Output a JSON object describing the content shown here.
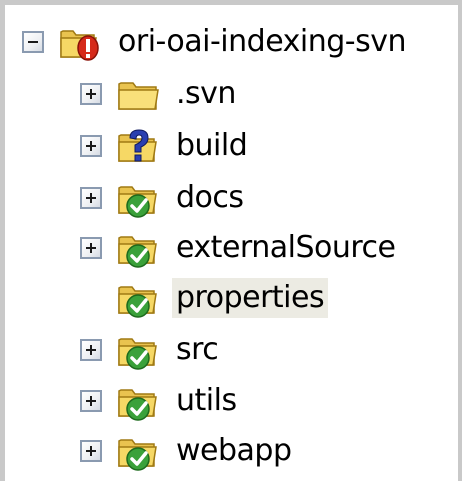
{
  "tree": {
    "root": {
      "label": "ori-oai-indexing-svn",
      "expanded": true,
      "status": "conflict",
      "icon": "folder-conflict-icon"
    },
    "children": [
      {
        "label": ".svn",
        "expandable": true,
        "status": "none",
        "icon": "folder-icon"
      },
      {
        "label": "build",
        "expandable": true,
        "status": "unversioned",
        "icon": "folder-question-icon"
      },
      {
        "label": "docs",
        "expandable": true,
        "status": "normal",
        "icon": "folder-ok-icon"
      },
      {
        "label": "externalSource",
        "expandable": true,
        "status": "normal",
        "icon": "folder-ok-icon"
      },
      {
        "label": "properties",
        "expandable": false,
        "status": "normal",
        "icon": "folder-ok-icon",
        "selected": true
      },
      {
        "label": "src",
        "expandable": true,
        "status": "normal",
        "icon": "folder-ok-icon"
      },
      {
        "label": "utils",
        "expandable": true,
        "status": "normal",
        "icon": "folder-ok-icon"
      },
      {
        "label": "webapp",
        "expandable": true,
        "status": "normal",
        "icon": "folder-ok-icon"
      }
    ]
  },
  "colors": {
    "frame_border": "#c9c9c9",
    "selection_bg": "#ecebe3",
    "folder_yellow": "#f6d865",
    "overlay_green": "#3aa13a",
    "overlay_red": "#d62a1a",
    "overlay_blue": "#2a3fb0"
  }
}
